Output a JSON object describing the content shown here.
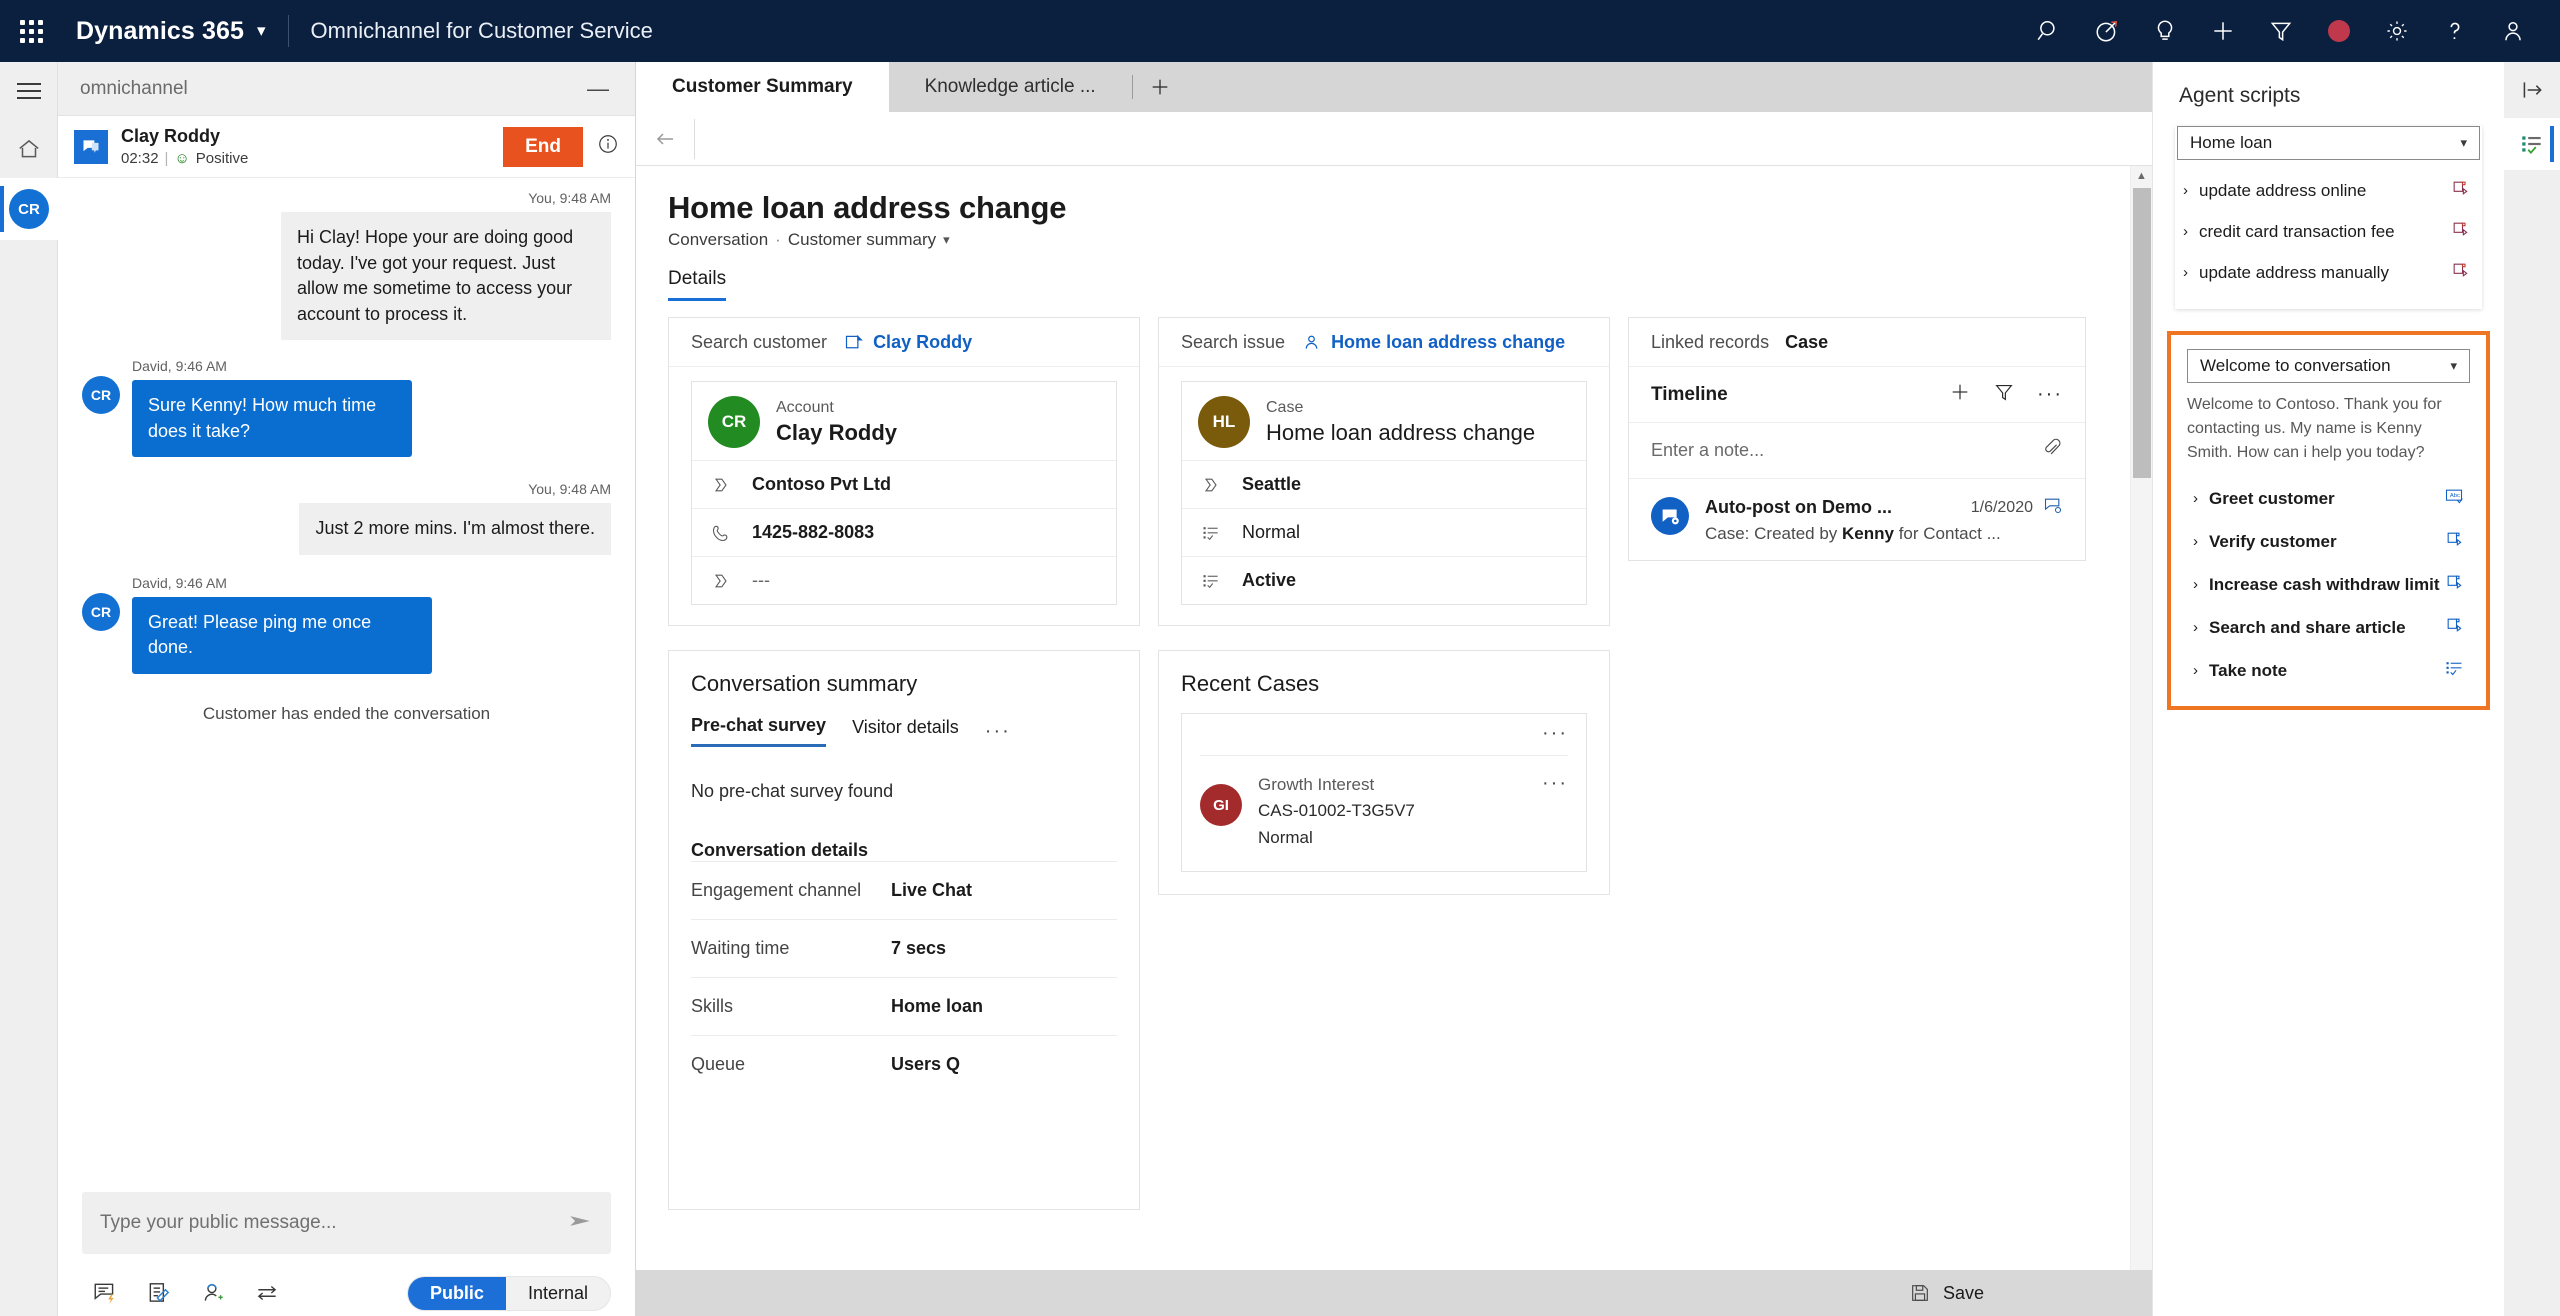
{
  "topnav": {
    "brand": "Dynamics 365",
    "app_name": "Omnichannel for Customer Service",
    "icons": [
      "search-icon",
      "target-arrow-icon",
      "lightbulb-icon",
      "plus-icon",
      "filter-icon",
      "presence-busy-icon",
      "gear-icon",
      "help-icon",
      "user-account-icon"
    ]
  },
  "leftrail": {
    "menu": "hamburger-menu-icon",
    "home": "home-icon",
    "avatar_initials": "CR"
  },
  "chat": {
    "search_value": "omnichannel",
    "minimize": "—",
    "customer_name": "Clay Roddy",
    "timer": "02:32",
    "sentiment": "Positive",
    "end_label": "End",
    "messages": [
      {
        "direction": "out",
        "author_time": "You, 9:48 AM",
        "text": "Hi Clay! Hope your are doing good today. I've got your request. Just allow me sometime to access your account to process it."
      },
      {
        "direction": "in",
        "author_time": "David, 9:46 AM",
        "avatar": "CR",
        "text": "Sure Kenny! How much time does it take?"
      },
      {
        "direction": "out",
        "author_time": "You, 9:48 AM",
        "text": "Just 2 more mins. I'm almost there."
      },
      {
        "direction": "in",
        "author_time": "David, 9:46 AM",
        "avatar": "CR",
        "text": "Great! Please ping me once done."
      }
    ],
    "system_note": "Customer has ended the conversation",
    "composer_placeholder": "Type your public message...",
    "tools": [
      "quick-reply-icon",
      "note-icon",
      "consult-agent-icon",
      "transfer-icon"
    ],
    "visibility": {
      "public": "Public",
      "internal": "Internal",
      "selected": "Public"
    }
  },
  "main": {
    "tabs": [
      {
        "label": "Customer Summary",
        "active": true
      },
      {
        "label": "Knowledge article ...",
        "active": false
      }
    ],
    "add_tab": "+",
    "page_title": "Home loan address change",
    "breadcrumb_entity": "Conversation",
    "breadcrumb_form": "Customer summary",
    "section_tab": "Details",
    "customer_card": {
      "search_label": "Search customer",
      "link": "Clay Roddy",
      "entity_type": "Account",
      "entity_name": "Clay Roddy",
      "avatar_initials": "CR",
      "avatar_color": "#228b22",
      "rows": [
        {
          "icon": "chevron-tag-icon",
          "value": "Contoso Pvt Ltd"
        },
        {
          "icon": "phone-icon",
          "value": "1425-882-8083"
        },
        {
          "icon": "chevron-tag-icon",
          "value": "---"
        }
      ]
    },
    "issue_card": {
      "search_label": "Search issue",
      "link": "Home loan address  change",
      "entity_type": "Case",
      "entity_name": "Home loan address change",
      "avatar_initials": "HL",
      "avatar_color": "#7a5b0c",
      "rows": [
        {
          "icon": "chevron-tag-icon",
          "value": "Seattle"
        },
        {
          "icon": "list-check-icon",
          "value": "Normal"
        },
        {
          "icon": "list-check-icon",
          "value": "Active"
        }
      ]
    },
    "linked_card": {
      "label": "Linked records",
      "value": "Case",
      "timeline_title": "Timeline",
      "timeline_actions": [
        "plus-icon",
        "filter-icon",
        "more-icon"
      ],
      "note_placeholder": "Enter a note...",
      "attach_icon": "paperclip-icon",
      "item": {
        "title": "Auto-post on Demo ...",
        "date": "1/6/2020",
        "subtitle_prefix": "Case: Created by ",
        "subtitle_bold": "Kenny",
        "subtitle_suffix": " for Contact ..."
      }
    },
    "conversation_summary": {
      "title": "Conversation summary",
      "tabs": [
        {
          "label": "Pre-chat survey",
          "active": true
        },
        {
          "label": "Visitor details",
          "active": false
        }
      ],
      "more": "···",
      "empty": "No pre-chat survey found",
      "details_title": "Conversation details",
      "details": [
        {
          "key": "Engagement channel",
          "value": "Live Chat"
        },
        {
          "key": "Waiting time",
          "value": "7 secs"
        },
        {
          "key": "Skills",
          "value": "Home loan"
        },
        {
          "key": "Queue",
          "value": "Users Q"
        }
      ]
    },
    "recent_cases": {
      "title": "Recent Cases",
      "items": [
        {
          "name": "Growth Interest",
          "number": "CAS-01002-T3G5V7",
          "priority": "Normal",
          "avatar_initials": "GI"
        }
      ]
    },
    "save_label": "Save"
  },
  "agent_scripts": {
    "title": "Agent scripts",
    "selected_script": "Home loan",
    "items": [
      {
        "label": "update address online",
        "icon": "run-script-icon"
      },
      {
        "label": "credit card transaction fee",
        "icon": "run-script-icon"
      },
      {
        "label": "update address manually",
        "icon": "run-script-icon"
      }
    ],
    "highlight_color": "#ef7522",
    "welcome_panel": {
      "selected": "Welcome to conversation",
      "description": "Welcome to Contoso. Thank you for contacting us. My name is Kenny Smith. How can i help you today?",
      "steps": [
        {
          "label": "Greet customer",
          "icon": "text-macro-icon"
        },
        {
          "label": "Verify customer",
          "icon": "run-script-icon"
        },
        {
          "label": "Increase cash withdraw limit",
          "icon": "run-script-icon"
        },
        {
          "label": "Search and share article",
          "icon": "run-script-icon"
        },
        {
          "label": "Take note",
          "icon": "list-check-icon"
        }
      ]
    }
  },
  "rightrail": {
    "expand": "expand-panel-icon",
    "items": [
      {
        "icon": "agent-scripts-icon",
        "selected": true
      }
    ]
  }
}
